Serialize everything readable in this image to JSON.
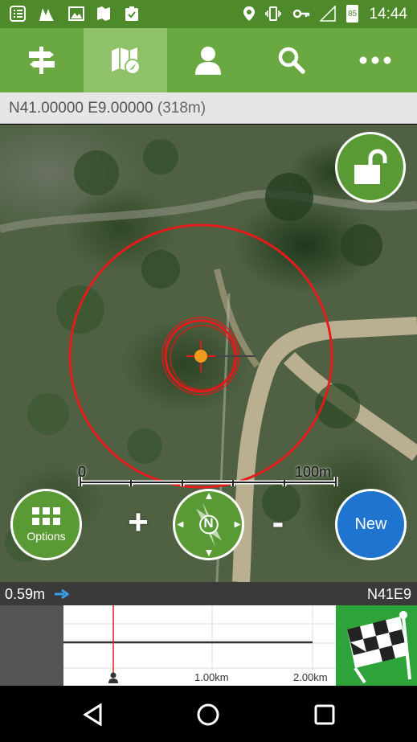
{
  "status_bar": {
    "time": "14:44",
    "battery": "85",
    "left_icons": [
      "list-icon",
      "peaks-icon",
      "image-icon",
      "map-pieces-icon",
      "clipboard-check-icon"
    ],
    "right_icons": [
      "location-pin-icon",
      "vibrate-icon",
      "key-icon",
      "signal-icon",
      "battery-icon"
    ]
  },
  "toolbar": {
    "tabs": [
      {
        "icon": "signpost-icon",
        "active": false
      },
      {
        "icon": "map-compass-icon",
        "active": true
      },
      {
        "icon": "person-icon",
        "active": false
      },
      {
        "icon": "search-icon",
        "active": false
      },
      {
        "icon": "more-icon",
        "active": false
      }
    ]
  },
  "coordinates": {
    "position": "N41.00000 E9.00000",
    "altitude": "(318m)"
  },
  "map": {
    "scale_start": "0",
    "scale_end": "100m",
    "options_label": "Options",
    "zoom_in": "+",
    "zoom_out": "-",
    "compass_letter": "N",
    "new_label": "New",
    "colors": {
      "accuracy_circle": "#e31b1b",
      "green_button": "#5a9a35",
      "new_button": "#1f74d0"
    }
  },
  "info_bar": {
    "distance": "0.59m",
    "grid_ref": "N41E9"
  },
  "elevation_profile": {
    "tick_1": "1.00km",
    "tick_2": "2.00km"
  }
}
